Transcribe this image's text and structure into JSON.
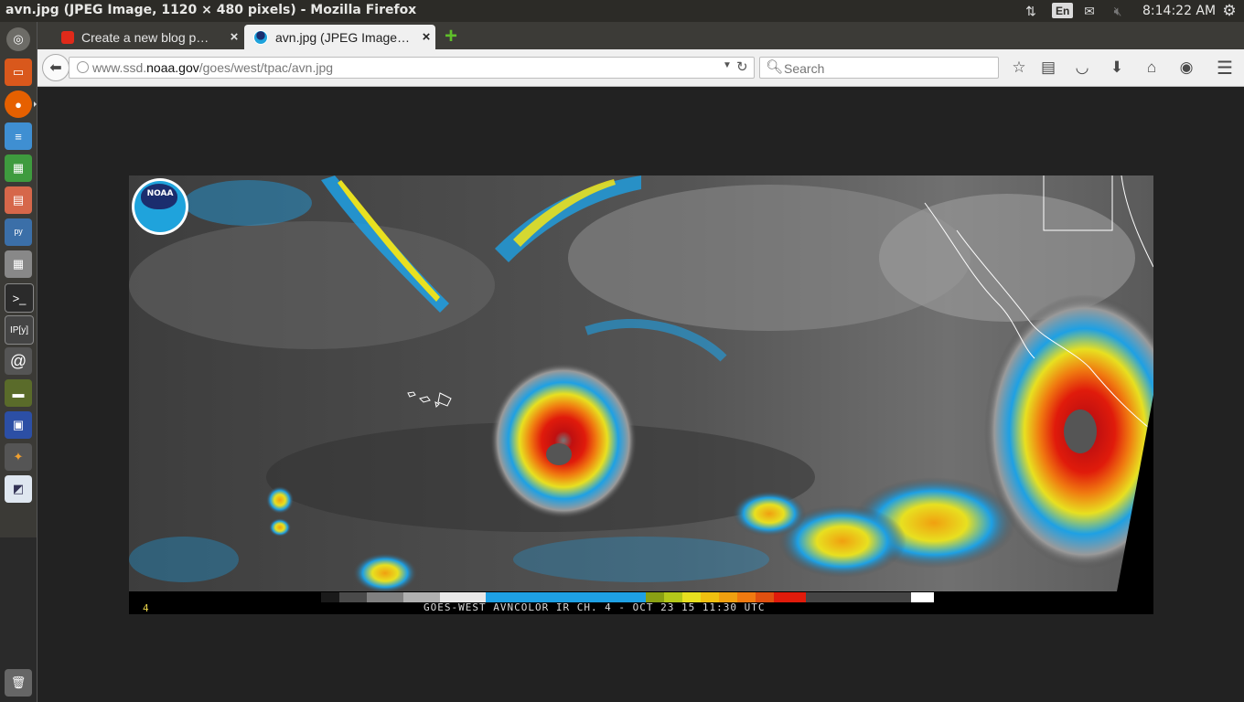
{
  "system": {
    "window_title": "avn.jpg (JPEG Image, 1120 × 480 pixels) - Mozilla Firefox",
    "keyboard_layout": "En",
    "clock": "8:14:22 AM",
    "icons": [
      "network-arrows-icon",
      "mail-icon",
      "volume-muted-icon",
      "gear-icon"
    ]
  },
  "tabs": [
    {
      "label": "Create a new blog p…",
      "icon": "blogger-icon",
      "active": false
    },
    {
      "label": "avn.jpg (JPEG Image…",
      "icon": "noaa-icon",
      "active": true
    }
  ],
  "nav": {
    "url_prefix": "www.ssd.",
    "url_domain": "noaa.gov",
    "url_path": "/goes/west/tpac/avn.jpg",
    "search_placeholder": "Search"
  },
  "image": {
    "logo_text": "NOAA",
    "channel_label": "4",
    "caption": "GOES-WEST AVNCOLOR IR CH. 4  - OCT 23 15 11:30 UTC"
  },
  "colors": {
    "ubuntu_panel": "#2c2b27",
    "launcher": "#3b3a36",
    "accent_red": "#e01b0b",
    "cloud_cyan": "#1ea0e4"
  }
}
